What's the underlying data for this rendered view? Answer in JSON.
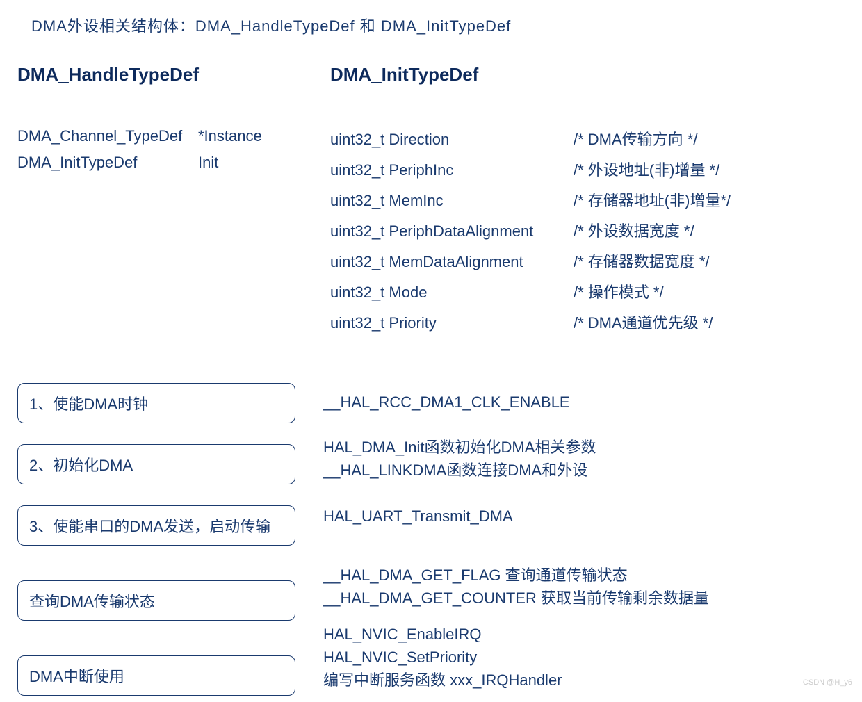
{
  "intro": "DMA外设相关结构体：DMA_HandleTypeDef 和 DMA_InitTypeDef",
  "left": {
    "heading": "DMA_HandleTypeDef",
    "rows": [
      {
        "type": "DMA_Channel_TypeDef",
        "name": "*Instance"
      },
      {
        "type": "DMA_InitTypeDef",
        "name": "Init"
      }
    ]
  },
  "right": {
    "heading": "DMA_InitTypeDef",
    "rows": [
      {
        "type": "uint32_t Direction",
        "comment": "/* DMA传输方向 */"
      },
      {
        "type": "uint32_t PeriphInc",
        "comment": "/* 外设地址(非)增量 */"
      },
      {
        "type": "uint32_t MemInc",
        "comment": "/* 存储器地址(非)增量*/"
      },
      {
        "type": "uint32_t PeriphDataAlignment",
        "comment": "/* 外设数据宽度 */"
      },
      {
        "type": "uint32_t MemDataAlignment",
        "comment": "/* 存储器数据宽度 */"
      },
      {
        "type": "uint32_t Mode",
        "comment": "/* 操作模式 */"
      },
      {
        "type": "uint32_t Priority",
        "comment": "/* DMA通道优先级 */"
      }
    ]
  },
  "steps": {
    "items": [
      {
        "label": "1、使能DMA时钟",
        "desc": [
          "__HAL_RCC_DMA1_CLK_ENABLE"
        ]
      },
      {
        "label": "2、初始化DMA",
        "desc": [
          "HAL_DMA_Init函数初始化DMA相关参数",
          "__HAL_LINKDMA函数连接DMA和外设"
        ]
      },
      {
        "label": "3、使能串口的DMA发送，启动传输",
        "desc": [
          "HAL_UART_Transmit_DMA"
        ]
      },
      {
        "label": "查询DMA传输状态",
        "desc": [
          "__HAL_DMA_GET_FLAG 查询通道传输状态",
          "__HAL_DMA_GET_COUNTER 获取当前传输剩余数据量"
        ]
      },
      {
        "label": "DMA中断使用",
        "desc": [
          "HAL_NVIC_EnableIRQ",
          "HAL_NVIC_SetPriority",
          "编写中断服务函数 xxx_IRQHandler"
        ]
      }
    ]
  },
  "watermark": "CSDN @H_y6"
}
